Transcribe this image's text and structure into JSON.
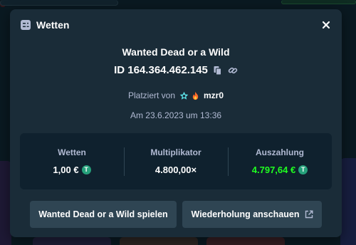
{
  "modal": {
    "title": "Wetten",
    "close_icon": "close-icon",
    "game_title": "Wanted Dead or a Wild",
    "bet_id": "ID 164.364.462.145",
    "placed_by_label": "Platziert von",
    "username": "mzr0",
    "date": "Am 23.6.2023 um 13:36"
  },
  "stats": {
    "bet": {
      "label": "Wetten",
      "value": "1,00 €"
    },
    "multiplier": {
      "label": "Multiplikator",
      "value": "4.800,00×"
    },
    "payout": {
      "label": "Auszahlung",
      "value": "4.797,64 €"
    }
  },
  "coin_glyph": "T",
  "buttons": {
    "play": "Wanted Dead or a Wild spielen",
    "replay": "Wiederholung anschauen"
  },
  "colors": {
    "modal_bg": "#1a2c38",
    "panel_bg": "#0f212e",
    "button_bg": "#2f4553",
    "muted_text": "#b1bad3",
    "payout_green": "#1fff20",
    "tether_green": "#26a17b"
  }
}
